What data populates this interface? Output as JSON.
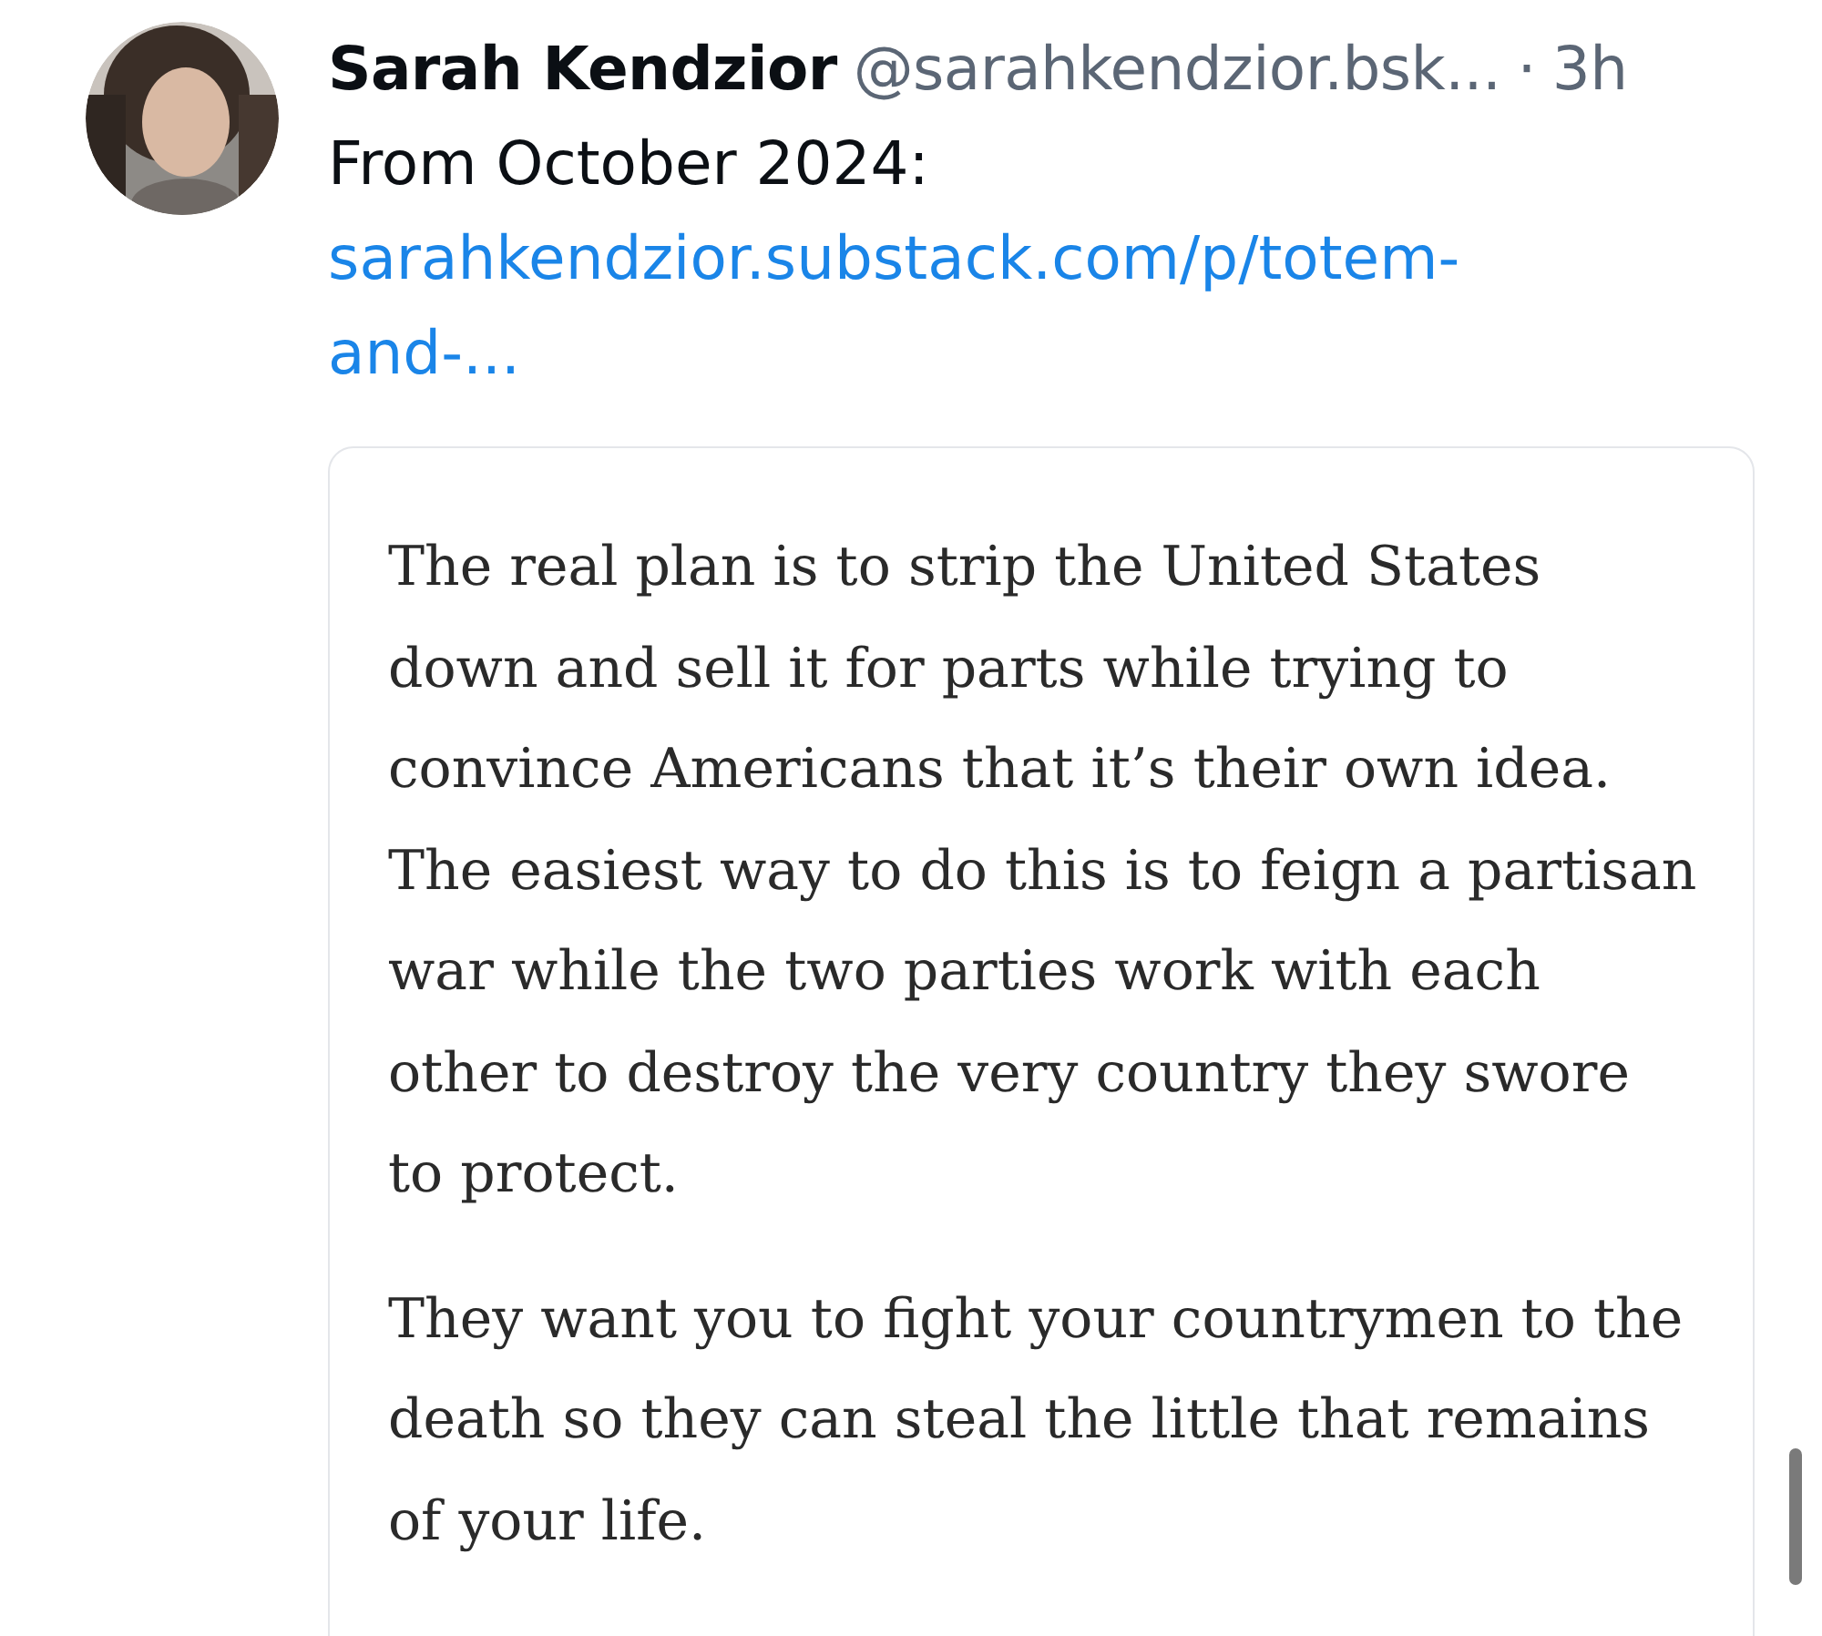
{
  "post": {
    "author": "Sarah Kendzior",
    "handle": "@sarahkendzior.bsk...",
    "separator": "·",
    "time": "3h",
    "text": "From October 2024:",
    "link": "sarahkendzior.substack.com/p/totem-and-...",
    "quote_card": {
      "paragraphs": [
        "The real plan is to strip the United States down and sell it for parts while trying to convince Americans that it’s their own idea. The easiest way to do this is to feign a partisan war while the two parties work with each other to destroy the very country they swore to protect.",
        "They want you to fight your countrymen to the death so they can steal the little that remains of your life."
      ]
    }
  }
}
